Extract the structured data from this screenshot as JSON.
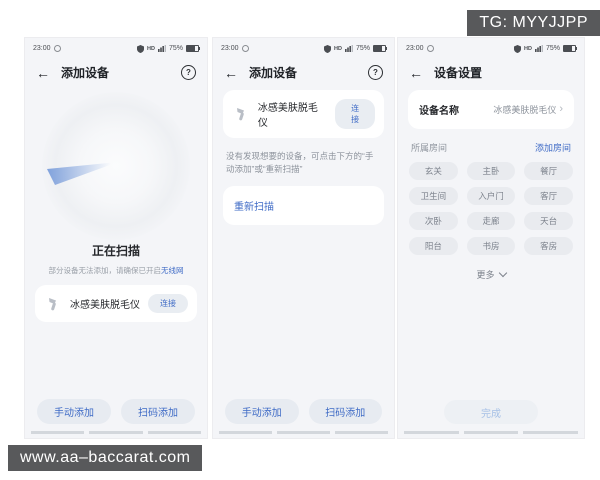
{
  "badges": {
    "top": "TG: MYYJJPP",
    "bottom": "www.aa–baccarat.com"
  },
  "status_bar": {
    "time": "23:00",
    "hd_label": "HD",
    "battery_percent": "75%"
  },
  "icons": {
    "back": "←",
    "help": "?",
    "chevron_right": "›"
  },
  "screen1": {
    "header_title": "添加设备",
    "scanning_title": "正在扫描",
    "scanning_hint": "部分设备无法添加，请确保已开启",
    "wifi_link": "无线网",
    "device_name": "冰感美肤脱毛仪",
    "connect_label": "连接",
    "manual_add_label": "手动添加",
    "scan_add_label": "扫码添加"
  },
  "screen2": {
    "header_title": "添加设备",
    "device_name": "冰感美肤脱毛仪",
    "connect_label": "连接",
    "empty_hint": "没有发现想要的设备，可点击下方的“手动添加”或“重新扫描”",
    "rescan_label": "重新扫描",
    "manual_add_label": "手动添加",
    "scan_add_label": "扫码添加"
  },
  "screen3": {
    "header_title": "设备设置",
    "device_name_label": "设备名称",
    "device_name_value": "冰感美肤脱毛仪",
    "room_section_label": "所属房间",
    "add_room_label": "添加房间",
    "rooms": [
      "玄关",
      "主卧",
      "餐厅",
      "卫生间",
      "入户门",
      "客厅",
      "次卧",
      "走廊",
      "天台",
      "阳台",
      "书房",
      "客房"
    ],
    "more_label": "更多",
    "done_label": "完成"
  },
  "colors": {
    "accent_blue": "#3f6bc6",
    "screen_bg": "#f4f5f8",
    "badge_bg": "#58595b"
  }
}
